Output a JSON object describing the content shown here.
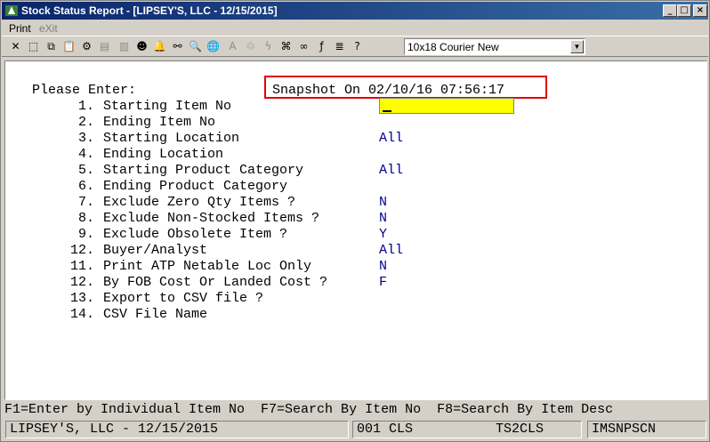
{
  "window": {
    "title": "Stock Status Report - [LIPSEY'S, LLC - 12/15/2015]"
  },
  "menu": [
    {
      "label": "Print",
      "enabled": true
    },
    {
      "label": "eXit",
      "enabled": false
    }
  ],
  "toolbar": {
    "font_select_value": "10x18 Courier New"
  },
  "form": {
    "heading": "Please Enter:",
    "snapshot": "Snapshot On 02/10/16 07:56:17",
    "lines": [
      {
        "num": "1.",
        "label": "Starting Item No",
        "value": ""
      },
      {
        "num": "2.",
        "label": "Ending Item No",
        "value": ""
      },
      {
        "num": "3.",
        "label": "Starting Location",
        "value": "All"
      },
      {
        "num": "4.",
        "label": "Ending Location",
        "value": ""
      },
      {
        "num": "5.",
        "label": "Starting Product Category",
        "value": "All"
      },
      {
        "num": "6.",
        "label": "Ending Product Category",
        "value": ""
      },
      {
        "num": "7.",
        "label": "Exclude Zero Qty Items ?",
        "value": "N"
      },
      {
        "num": "8.",
        "label": "Exclude Non-Stocked Items ?",
        "value": "N"
      },
      {
        "num": "9.",
        "label": "Exclude Obsolete Item ?",
        "value": "Y"
      },
      {
        "num": "12.",
        "label": "Buyer/Analyst",
        "value": "All"
      },
      {
        "num": "11.",
        "label": "Print ATP Netable Loc Only",
        "value": "N"
      },
      {
        "num": "12.",
        "label": "By FOB Cost Or Landed Cost ?",
        "value": "F"
      },
      {
        "num": "13.",
        "label": "Export to CSV file ?",
        "value": ""
      },
      {
        "num": "14.",
        "label": "CSV File Name",
        "value": ""
      }
    ]
  },
  "function_keys": "F1=Enter by Individual Item No  F7=Search By Item No  F8=Search By Item Desc",
  "status": {
    "company": "LIPSEY'S, LLC - 12/15/2015",
    "code": "001 CLS",
    "server": "TS2CLS",
    "program": "IMSNPSCN"
  }
}
